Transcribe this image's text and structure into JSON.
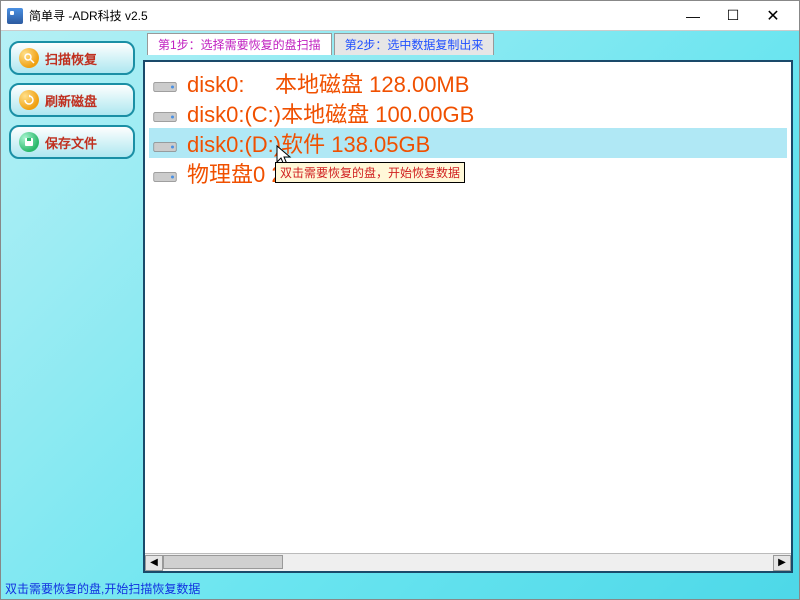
{
  "window": {
    "title": "简单寻  -ADR科技 v2.5"
  },
  "sidebar": {
    "items": [
      {
        "label": "扫描恢复"
      },
      {
        "label": "刷新磁盘"
      },
      {
        "label": "保存文件"
      }
    ]
  },
  "tabs": {
    "step1": "第1步：选择需要恢复的盘扫描",
    "step2": "第2步：选中数据复制出来"
  },
  "disks": {
    "rows": [
      {
        "text": "disk0:     本地磁盘 128.00MB",
        "selected": false
      },
      {
        "text": "disk0:(C:)本地磁盘 100.00GB",
        "selected": false
      },
      {
        "text": "disk0:(D:)软件 138.05GB",
        "selected": true
      },
      {
        "text": "物理盘0 238.47GB",
        "selected": false
      }
    ]
  },
  "tooltip": {
    "text": "双击需要恢复的盘，开始恢复数据"
  },
  "status": {
    "text": "双击需要恢复的盘,开始扫描恢复数据"
  },
  "scroll": {
    "left_arrow": "◀",
    "right_arrow": "▶"
  }
}
